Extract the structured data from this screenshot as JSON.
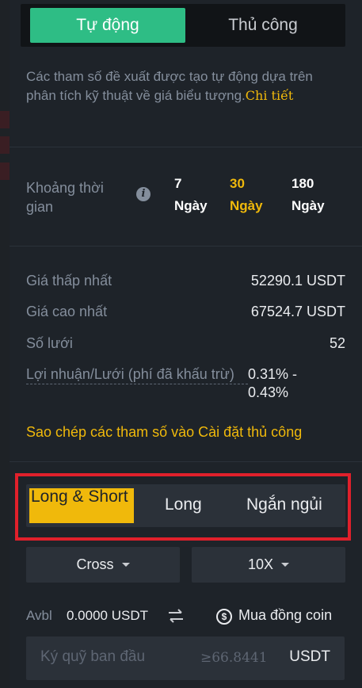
{
  "mode_toggle": {
    "auto_label": "Tự động",
    "manual_label": "Thủ công"
  },
  "description": {
    "text": "Các tham số đề xuất được tạo tự động dựa trên phân tích kỹ thuật về giá biểu tượng.",
    "link_label": "Chi tiết"
  },
  "period": {
    "label": "Khoảng thời gian",
    "options": [
      {
        "number": "7",
        "unit": "Ngày"
      },
      {
        "number": "30",
        "unit": "Ngày"
      },
      {
        "number": "180",
        "unit": "Ngày"
      }
    ],
    "selected_index": 1
  },
  "params": {
    "lowest_price": {
      "label": "Giá thấp nhất",
      "value": "52290.1 USDT"
    },
    "highest_price": {
      "label": "Giá cao nhất",
      "value": "67524.7 USDT"
    },
    "grid_count": {
      "label": "Số lưới",
      "value": "52"
    },
    "profit_per_grid": {
      "label": "Lợi nhuận/Lưới (phí đã khấu trừ)",
      "value": "0.31% - 0.43%"
    }
  },
  "copy_link_label": "Sao chép các tham số vào Cài đặt thủ công",
  "direction": {
    "options": [
      "Long & Short",
      "Long",
      "Ngắn ngủi"
    ],
    "selected_index": 0
  },
  "margin_mode": {
    "value": "Cross"
  },
  "leverage": {
    "value": "10X"
  },
  "avbl": {
    "label": "Avbl",
    "value": "0.0000 USDT",
    "buy_coin_label": "Mua đồng coin"
  },
  "initial_margin": {
    "placeholder": "Ký quỹ ban đầu",
    "min_hint": "≥66.8441",
    "unit": "USDT"
  },
  "icons": {
    "info": "info-icon",
    "transfer": "transfer-arrows-icon",
    "coin": "dollar-coin-icon",
    "caret": "caret-down-icon"
  },
  "colors": {
    "accent": "#f0b90b",
    "active_green": "#2ebd85",
    "highlight_red": "#e0202b"
  }
}
